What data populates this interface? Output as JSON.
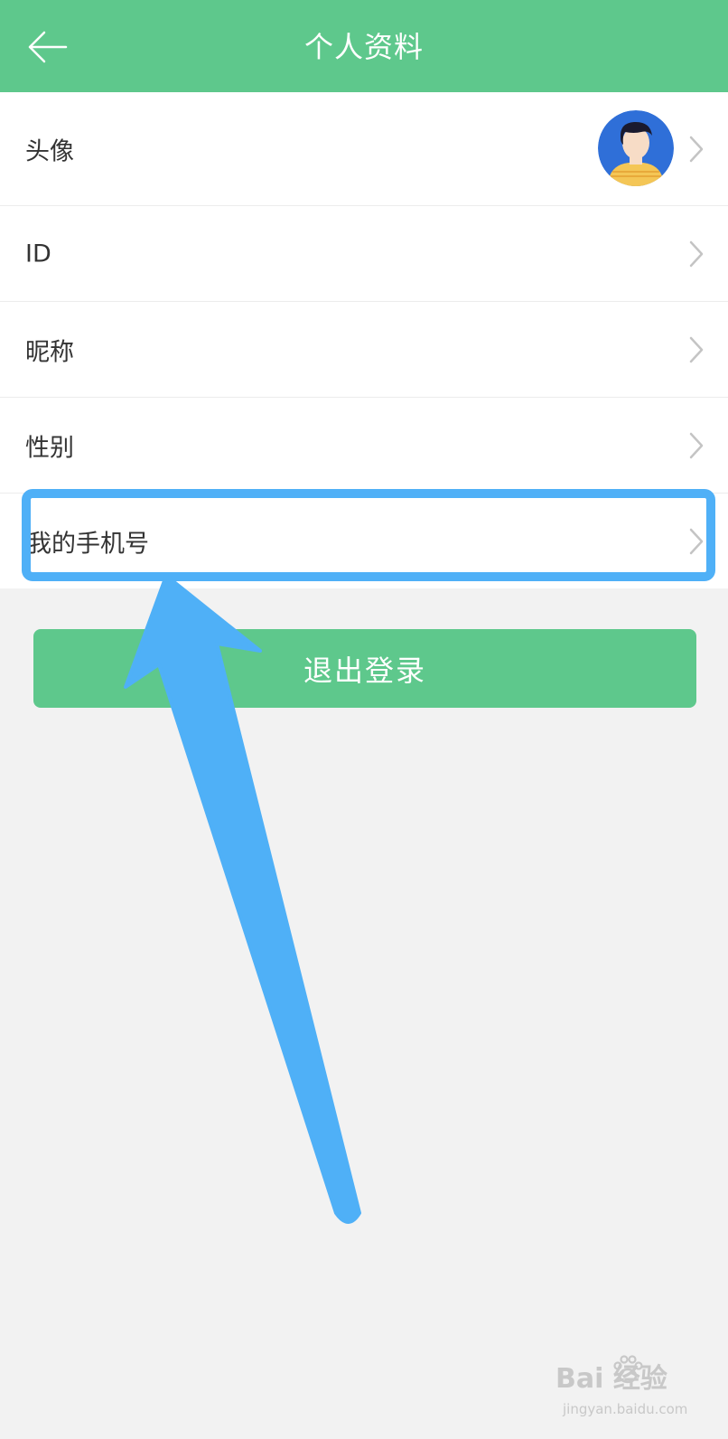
{
  "header": {
    "title": "个人资料",
    "back_icon": "arrow-left-icon",
    "color": "#5ec88c"
  },
  "profile_rows": [
    {
      "label": "头像",
      "icon": "chevron-right-icon"
    },
    {
      "label": "ID",
      "icon": "chevron-right-icon"
    },
    {
      "label": "昵称",
      "icon": "chevron-right-icon"
    },
    {
      "label": "性别",
      "icon": "chevron-right-icon"
    },
    {
      "label": "我的手机号",
      "icon": "chevron-right-icon"
    }
  ],
  "logout": {
    "label": "退出登录",
    "color": "#5ec88c"
  },
  "annotation": {
    "highlight_color": "#4fb0f7"
  },
  "watermark": {
    "brand": "Bai  经验",
    "url": "jingyan.baidu.com"
  }
}
